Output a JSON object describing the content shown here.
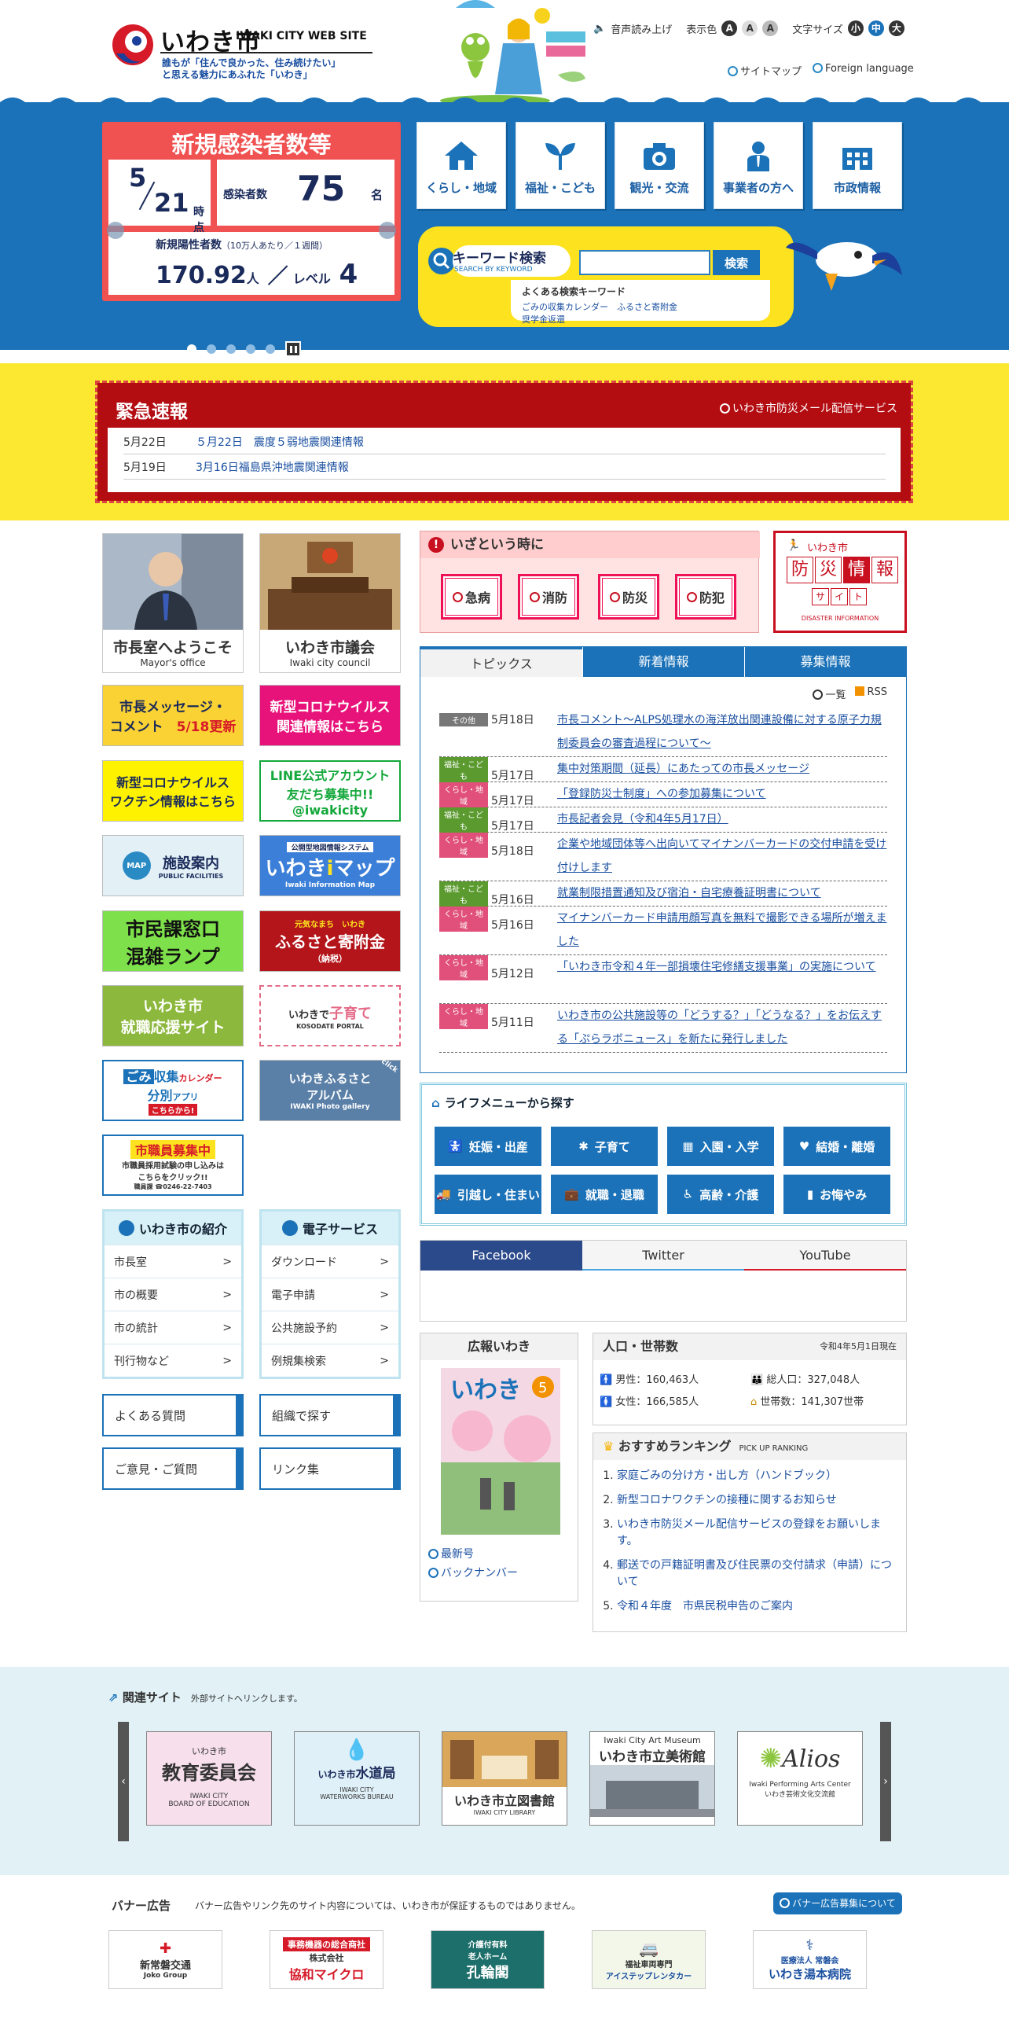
{
  "header": {
    "logo_jp": "いわき市",
    "logo_en": "IWAKI CITY WEB SITE",
    "tagline1": "誰もが「住んで良かった、住み続けたい」",
    "tagline2": "と思える魅力にあふれた「いわき」",
    "read_aloud": "音声読み上げ",
    "color_label": "表示色",
    "color_opts": [
      "A",
      "A",
      "A"
    ],
    "font_label": "文字サイズ",
    "font_opts": [
      "小",
      "中",
      "大"
    ],
    "sitemap": "サイトマップ",
    "foreign": "Foreign language"
  },
  "covid": {
    "title": "新規感染者数等",
    "month": "5",
    "day": "21",
    "time_unit": "時点",
    "infected_label": "感染者数",
    "infected_value": "75",
    "infected_unit": "名",
    "positive_label": "新規陽性者数",
    "positive_note": "（10万人あたり／１週間）",
    "positive_value": "170.92",
    "positive_unit": "人",
    "level_sep": "／",
    "level_label": "レベル",
    "level_value": "4"
  },
  "nav": [
    "くらし・地域",
    "福祉・こども",
    "観光・交流",
    "事業者の方へ",
    "市政情報"
  ],
  "search": {
    "title": "キーワード検索",
    "subtitle": "SEARCH BY KEYWORD",
    "button": "検索",
    "kw_title": "よくある検索キーワード",
    "kw": [
      "ごみの収集カレンダー",
      "ふるさと寄附金",
      "奨学金返還"
    ]
  },
  "emergency": {
    "title": "緊急速報",
    "service": "いわき市防災メール配信サービス",
    "items": [
      {
        "date": "5月22日",
        "text": "５月22日　震度５弱地震関連情報"
      },
      {
        "date": "5月19日",
        "text": "3月16日福島県沖地震関連情報"
      }
    ]
  },
  "left": {
    "mayor_jp": "市長室へようこそ",
    "mayor_en": "Mayor's office",
    "council_jp": "いわき市議会",
    "council_en": "Iwaki city council",
    "t1a": "市長メッセージ・",
    "t1b": "コメント",
    "t1c": "5/18更新",
    "t2a": "新型コロナウイルス",
    "t2b": "関連情報はこちら",
    "t3a": "新型コロナウイルス",
    "t3b": "ワクチン情報はこちら",
    "t4a": "LINE公式アカウント",
    "t4b": "友だち募集中!!",
    "t4c": "@iwakicity",
    "t5a": "施設案内",
    "t5b": "PUBLIC FACILITIES",
    "t5m": "MAP",
    "t6a": "公開型地図情報システム",
    "t6b": "いわき",
    "t6bi": "i",
    "t6bm": "マップ",
    "t6c": "Iwaki Information Map",
    "t7a": "市民課窓口",
    "t7b": "混雑ランプ",
    "t8a": "元気なまち　いわき",
    "t8b": "ふるさと寄附金",
    "t8c": "（納税）",
    "t9a": "いわき市",
    "t9b": "就職応援サイト",
    "t10a": "いわきで",
    "t10b": "子育て",
    "t10c": "KOSODATE PORTAL",
    "t11a": "ごみ",
    "t11b": "収集",
    "t11bb": "カレンダー",
    "t11c": "分別",
    "t11cc": "アプリ",
    "t11d": "こちらから!",
    "t12a": "いわきふるさと",
    "t12b": "アルバム",
    "t12c": "IWAKI Photo gallery",
    "t12d": "click",
    "t13a": "市職員募集中",
    "t13b": "市職員採用試験の申し込みは",
    "t13c": "こちらをクリック!!",
    "t13d": "職員課 ☎0246-22-7403"
  },
  "intro": {
    "title": "いわき市の紹介",
    "items": [
      "市長室",
      "市の概要",
      "市の統計",
      "刊行物など"
    ]
  },
  "eservice": {
    "title": "電子サービス",
    "items": [
      "ダウンロード",
      "電子申請",
      "公共施設予約",
      "例規集検索"
    ]
  },
  "quick": [
    "よくある質問",
    "組織で探す",
    "ご意見・ご質問",
    "リンク集"
  ],
  "pinch": {
    "title": "いざという時に",
    "items": [
      "急病",
      "消防",
      "防災",
      "防犯"
    ]
  },
  "disaster": {
    "top": "いわき市",
    "chars": [
      "防",
      "災",
      "情",
      "報"
    ],
    "sub": [
      "サ",
      "イ",
      "ト"
    ],
    "en": "DISASTER INFORMATION"
  },
  "topics": {
    "tabs": [
      "トピックス",
      "新着情報",
      "募集情報"
    ],
    "list_link": "一覧",
    "rss": "RSS",
    "rows": [
      {
        "tag": "その他",
        "color": "#777",
        "date": "5月18日",
        "text": "市長コメント～ALPS処理水の海洋放出関連設備に対する原子力規制委員会の審査過程について～"
      },
      {
        "tag": "福祉・こども",
        "color": "#5a9a2e",
        "date": "5月17日",
        "text": "集中対策期間（延長）にあたっての市長メッセージ"
      },
      {
        "tag": "くらし・地域",
        "color": "#e0507a",
        "date": "5月17日",
        "text": "「登録防災士制度」への参加募集について"
      },
      {
        "tag": "福祉・こども",
        "color": "#5a9a2e",
        "date": "5月17日",
        "text": "市長記者会見（令和4年5月17日）"
      },
      {
        "tag": "くらし・地域",
        "color": "#e0507a",
        "date": "5月18日",
        "text": "企業や地域団体等へ出向いてマイナンバーカードの交付申請を受け付けします"
      },
      {
        "tag": "福祉・こども",
        "color": "#5a9a2e",
        "date": "5月16日",
        "text": "就業制限措置通知及び宿泊・自宅療養証明書について"
      },
      {
        "tag": "くらし・地域",
        "color": "#e0507a",
        "date": "5月16日",
        "text": "マイナンバーカード申請用顔写真を無料で撮影できる場所が増えました"
      },
      {
        "tag": "くらし・地域",
        "color": "#e0507a",
        "date": "5月12日",
        "text": "「いわき市令和４年一部損壊住宅修繕支援事業」の実施について"
      },
      {
        "tag": "くらし・地域",
        "color": "#e0507a",
        "date": "5月11日",
        "text": "いわき市の公共施設等の「どうする？」「どうなる？」をお伝えする「ぷらラボニュース」を新たに発行しました"
      }
    ]
  },
  "life": {
    "title": "ライフメニューから探す",
    "items": [
      "妊娠・出産",
      "子育て",
      "入園・入学",
      "結婚・離婚",
      "引越し・住まい",
      "就職・退職",
      "高齢・介護",
      "お悔やみ"
    ]
  },
  "sns": {
    "tabs": [
      "Facebook",
      "Twitter",
      "YouTube"
    ]
  },
  "koho": {
    "title": "広報いわき",
    "cover_title": "いわき",
    "cover_num": "5",
    "links": [
      "最新号",
      "バックナンバー"
    ]
  },
  "population": {
    "title": "人口・世帯数",
    "as_of": "令和4年5月1日現在",
    "male": "男性：160,463人",
    "female": "女性：166,585人",
    "total": "総人口：327,048人",
    "households": "世帯数：141,307世帯"
  },
  "ranking": {
    "title": "おすすめランキング",
    "sub": "PICK UP RANKING",
    "items": [
      "家庭ごみの分け方・出し方（ハンドブック）",
      "新型コロナワクチンの接種に関するお知らせ",
      "いわき市防災メール配信サービスの登録をお願いします。",
      "郵送での戸籍証明書及び住民票の交付請求（申請）について",
      "令和４年度　市県民税申告のご案内"
    ]
  },
  "related": {
    "title": "関連サイト",
    "note": "外部サイトへリンクします。",
    "b1a": "いわき市",
    "b1b": "教育委員会",
    "b1c": "IWAKI CITY",
    "b1d": "BOARD OF EDUCATION",
    "b2a": "いわき市",
    "b2b": "水道局",
    "b2c": "IWAKI CITY",
    "b2d": "WATERWORKS BUREAU",
    "b3a": "いわき市立図書館",
    "b3b": "IWAKI CITY LIBRARY",
    "b4a": "Iwaki City Art Museum",
    "b4b": "いわき市立美術館",
    "b5a": "Alios",
    "b5b": "Iwaki Performing Arts Center",
    "b5c": "いわき芸術文化交流館"
  },
  "banners": {
    "title": "バナー広告",
    "note": "バナー広告やリンク先のサイト内容については、いわき市が保証するものではありません。",
    "about": "バナー広告募集について",
    "b1a": "新常磐交通",
    "b1b": "Joko Group",
    "b2a": "事務機器の総合商社",
    "b2b": "株式会社",
    "b2c": "協和マイクロ",
    "b3a": "介護付有料",
    "b3b": "老人ホーム",
    "b3c": "孔輪閣",
    "b4a": "福祉車両専門",
    "b4b": "アイステップレンタカー",
    "b5a": "医療法人 常磐会",
    "b5b": "いわき湯本病院"
  }
}
